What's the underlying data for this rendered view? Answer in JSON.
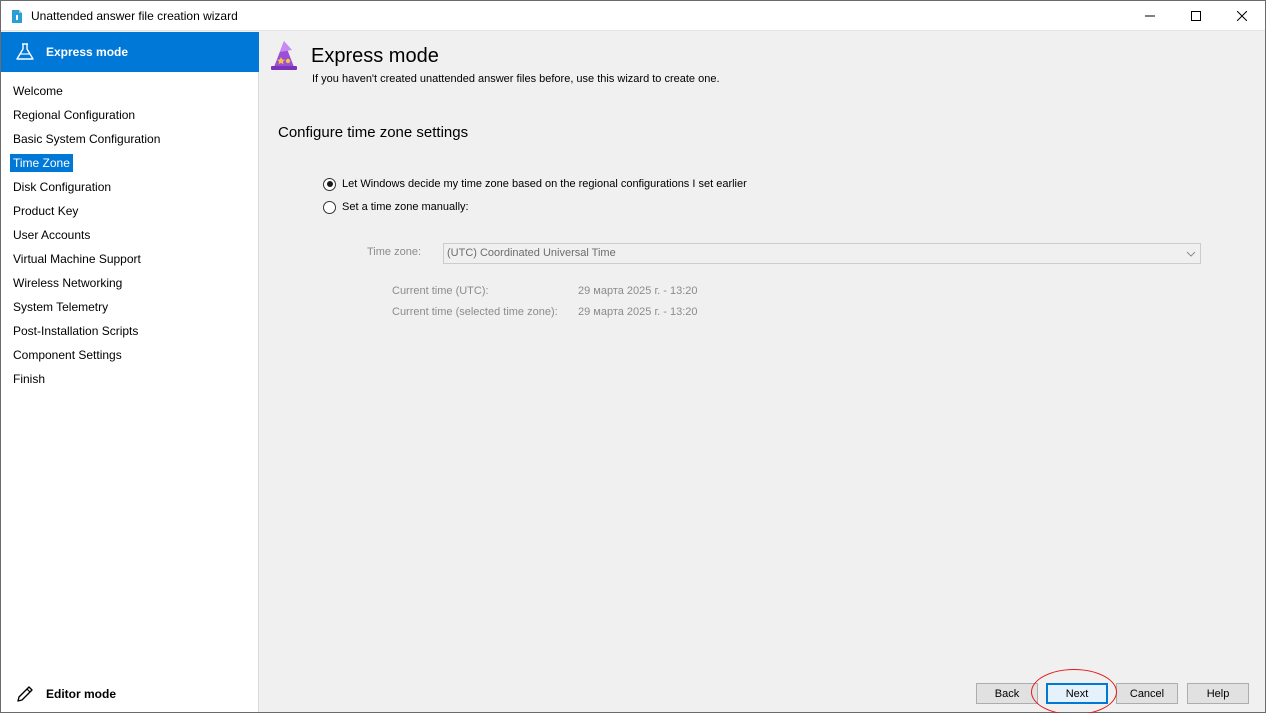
{
  "window": {
    "title": "Unattended answer file creation wizard",
    "controls": {
      "minimize": "minimize-icon",
      "maximize": "maximize-icon",
      "close": "close-icon"
    }
  },
  "sidebar": {
    "header_label": "Express mode",
    "items": [
      {
        "label": "Welcome"
      },
      {
        "label": "Regional Configuration"
      },
      {
        "label": "Basic System Configuration"
      },
      {
        "label": "Time Zone",
        "active": true
      },
      {
        "label": "Disk Configuration"
      },
      {
        "label": "Product Key"
      },
      {
        "label": "User Accounts"
      },
      {
        "label": "Virtual Machine Support"
      },
      {
        "label": "Wireless Networking"
      },
      {
        "label": "System Telemetry"
      },
      {
        "label": "Post-Installation Scripts"
      },
      {
        "label": "Component Settings"
      },
      {
        "label": "Finish"
      }
    ],
    "editor_mode_label": "Editor mode"
  },
  "header": {
    "title": "Express mode",
    "subtitle": "If you haven't created unattended answer files before, use this wizard to create one."
  },
  "section": {
    "title": "Configure time zone settings",
    "option_auto": "Let Windows decide my time zone based on the regional configurations I set earlier",
    "option_manual": "Set a time zone manually:",
    "selected_option": "auto",
    "timezone_label": "Time zone:",
    "timezone_value": "(UTC) Coordinated Universal Time",
    "current_time_utc_label": "Current time (UTC):",
    "current_time_utc_value": "29 марта 2025 г. - 13:20",
    "current_time_selected_label": "Current time (selected time zone):",
    "current_time_selected_value": "29 марта 2025 г. - 13:20"
  },
  "buttons": {
    "back": "Back",
    "next": "Next",
    "cancel": "Cancel",
    "help": "Help"
  },
  "colors": {
    "accent": "#0078d7",
    "annotation": "#e21b1b"
  }
}
